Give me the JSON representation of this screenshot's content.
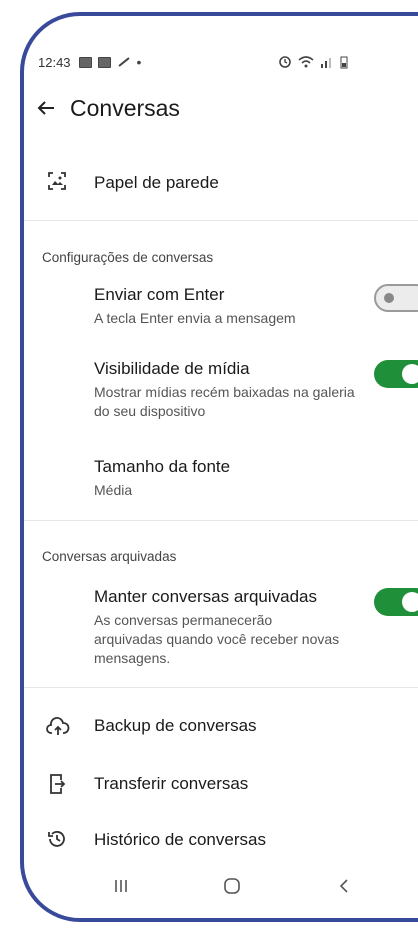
{
  "status_bar": {
    "time": "12:43"
  },
  "app_bar": {
    "title": "Conversas"
  },
  "wallpaper": {
    "label": "Papel de parede"
  },
  "chat_settings": {
    "header": "Configurações de conversas",
    "enter_send": {
      "title": "Enviar com Enter",
      "subtitle": "A tecla Enter envia a mensagem",
      "enabled": false
    },
    "media_visibility": {
      "title": "Visibilidade de mídia",
      "subtitle": "Mostrar mídias recém baixadas na galeria do seu dispositivo",
      "enabled": true
    },
    "font_size": {
      "title": "Tamanho da fonte",
      "value": "Média"
    }
  },
  "archived": {
    "header": "Conversas arquivadas",
    "keep_archived": {
      "title": "Manter conversas arquivadas",
      "subtitle": "As conversas permanecerão arquivadas quando você receber novas mensagens.",
      "enabled": true
    }
  },
  "more": {
    "backup": "Backup de conversas",
    "transfer": "Transferir conversas",
    "history": "Histórico de conversas"
  },
  "colors": {
    "accent": "#1f8f3a",
    "frame": "#3a4a9a"
  },
  "icons": [
    "wallpaper-icon",
    "cloud-upload-icon",
    "phone-transfer-icon",
    "history-icon"
  ]
}
